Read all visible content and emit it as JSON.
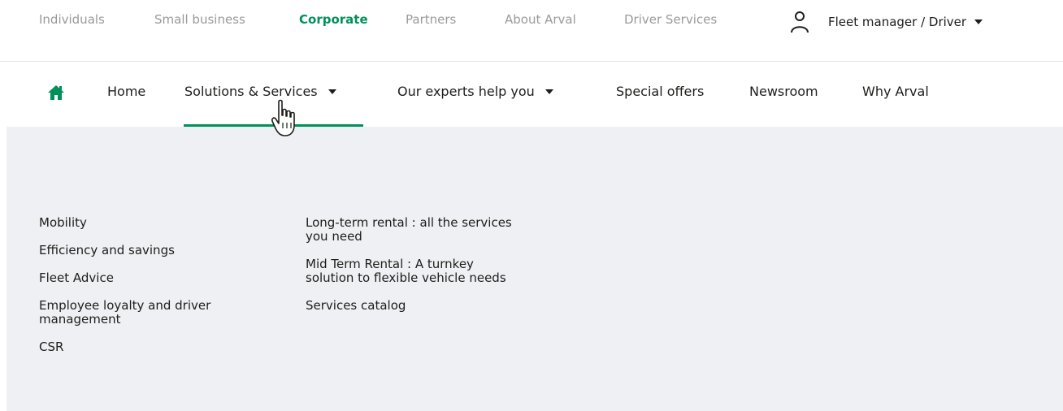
{
  "topbar": {
    "links": [
      {
        "label": "Individuals",
        "active": false
      },
      {
        "label": "Small business",
        "active": false
      },
      {
        "label": "Corporate",
        "active": true
      },
      {
        "label": "Partners",
        "active": false
      },
      {
        "label": "About Arval",
        "active": false
      },
      {
        "label": "Driver Services",
        "active": false
      }
    ],
    "user_menu": {
      "icon": "user-icon",
      "label": "Fleet manager / Driver"
    }
  },
  "mainnav": {
    "home_icon": "home-icon",
    "items": [
      {
        "label": "Home",
        "has_dropdown": false
      },
      {
        "label": "Solutions & Services",
        "has_dropdown": true,
        "active": true
      },
      {
        "label": "Our experts help you",
        "has_dropdown": true
      },
      {
        "label": "Special offers",
        "has_dropdown": false
      },
      {
        "label": "Newsroom",
        "has_dropdown": false
      },
      {
        "label": "Why Arval",
        "has_dropdown": false
      }
    ]
  },
  "megamenu": {
    "column1": [
      "Mobility",
      "Efficiency and savings",
      "Fleet Advice",
      "Employee loyalty and driver management",
      "CSR"
    ],
    "column2": [
      "Long-term rental : all the services you need",
      "Mid Term Rental : A turnkey solution to flexible vehicle needs",
      "Services catalog"
    ]
  },
  "colors": {
    "brand_green": "#00915a",
    "text_dark": "#1d1d1b",
    "text_muted": "#9a9a9a",
    "panel_bg": "#eef0f3"
  }
}
